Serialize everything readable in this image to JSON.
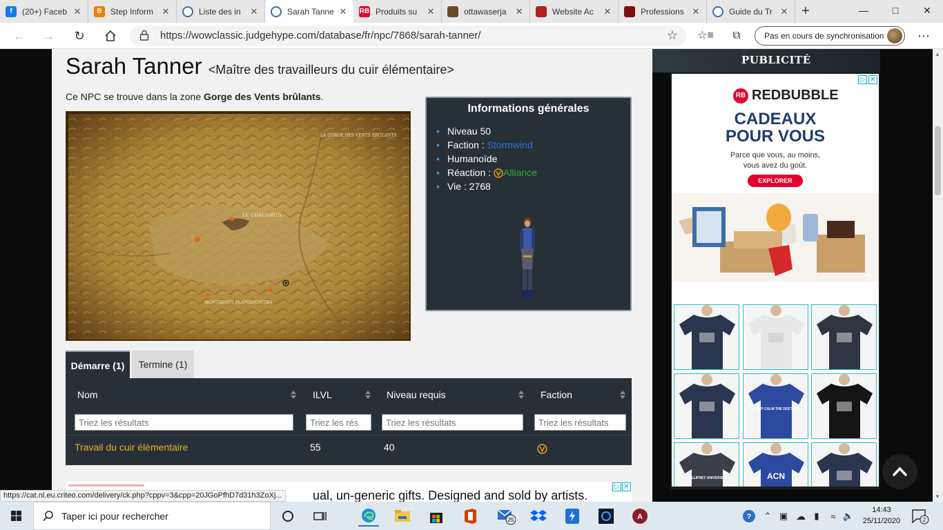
{
  "browser": {
    "tabs": [
      {
        "title": "(20+) Faceb",
        "icon": "facebook-icon",
        "color": "#1877f2",
        "glyph": "f"
      },
      {
        "title": "Step Inform",
        "icon": "blogger-icon",
        "color": "#f57d00",
        "glyph": "B"
      },
      {
        "title": "Liste des in",
        "icon": "judgehype-icon",
        "color": "#ffffff",
        "glyph": ""
      },
      {
        "title": "Sarah Tanne",
        "icon": "judgehype-icon",
        "color": "#ffffff",
        "glyph": ""
      },
      {
        "title": "Produits su",
        "icon": "redbubble-icon",
        "color": "#e4002b",
        "glyph": "RB"
      },
      {
        "title": "ottawaserja",
        "icon": "site-icon",
        "color": "#6b4a2a",
        "glyph": ""
      },
      {
        "title": "Website Ac",
        "icon": "site-icon",
        "color": "#b22222",
        "glyph": ""
      },
      {
        "title": "Professions",
        "icon": "site-icon",
        "color": "#7a1010",
        "glyph": ""
      },
      {
        "title": "Guide du Tr",
        "icon": "judgehype-icon",
        "color": "#ffffff",
        "glyph": ""
      }
    ],
    "active_tab": 3,
    "url": "https://wowclassic.judgehype.com/database/fr/npc/7868/sarah-tanner/",
    "sync_label": "Pas en cours de synchronisation",
    "status_url": "https://cat.nl.eu.criteo.com/delivery/ck.php?cppv=3&cpp=20JGoPfhD7d31h3ZoXj..."
  },
  "npc": {
    "name": "Sarah Tanner",
    "subtitle": "<Maître des travailleurs du cuir élémentaire>",
    "zone_prefix": "Ce NPC se trouve dans la zone ",
    "zone_name": "Gorge des Vents brûlants",
    "zone_suffix": "."
  },
  "map": {
    "labels": [
      "LE CHAUDRON",
      "MONTAGNES FLAMBOYANTES",
      "LA GORGE DES VENTS BRÛLANTS"
    ]
  },
  "info": {
    "title": "Informations générales",
    "level_label": "Niveau 50",
    "faction_label": "Faction : ",
    "faction_value": "Stormwind",
    "type_label": "Humanoïde",
    "reaction_label": "Réaction : ",
    "reaction_value": "Alliance",
    "health_label": "Vie : 2768"
  },
  "tabs": {
    "start": "Démarre (1)",
    "end": "Termine (1)"
  },
  "table": {
    "headers": {
      "name": "Nom",
      "ilvl": "ILVL",
      "level": "Niveau requis",
      "faction": "Faction"
    },
    "filter_placeholder": "Triez les résultats",
    "filter_placeholder_short": "Triez les rés",
    "rows": [
      {
        "name": "Travail du cuir élémentaire",
        "ilvl": "55",
        "level": "40",
        "faction_icon": "alliance-icon"
      }
    ]
  },
  "ad_banner": {
    "text": "ual, un-generic gifts. Designed and sold by artists."
  },
  "sidebar": {
    "header": "PUBLICITÉ",
    "brand": "REDBUBBLE",
    "title_line1": "CADEAUX",
    "title_line2": "POUR VOUS",
    "sub_line1": "Parce que vous, au moins,",
    "sub_line2": "vous avez du goût.",
    "cta": "EXPLORER",
    "shirts": [
      {
        "body": "#2a3550",
        "text": ""
      },
      {
        "body": "#e8e8e8",
        "text": ""
      },
      {
        "body": "#2f3642",
        "text": ""
      },
      {
        "body": "#2a3550",
        "text": ""
      },
      {
        "body": "#2b4aa0",
        "text": "KEEP CALM THE DOCTOR"
      },
      {
        "body": "#151515",
        "text": ""
      },
      {
        "body": "#3a3f4a",
        "text": "GALLIFREY UNIVERSITY"
      },
      {
        "body": "#2b4aa0",
        "text": "ACN"
      },
      {
        "body": "#2a3550",
        "text": ""
      }
    ]
  },
  "taskbar": {
    "search_placeholder": "Taper ici pour rechercher",
    "time": "14:43",
    "date": "25/11/2020",
    "mail_badge": "25",
    "notif_count": "2"
  },
  "colors": {
    "panel": "#263036",
    "quest_link": "#e7b52c",
    "faction_link": "#2d74d6",
    "alliance_green": "#2faa2f"
  }
}
